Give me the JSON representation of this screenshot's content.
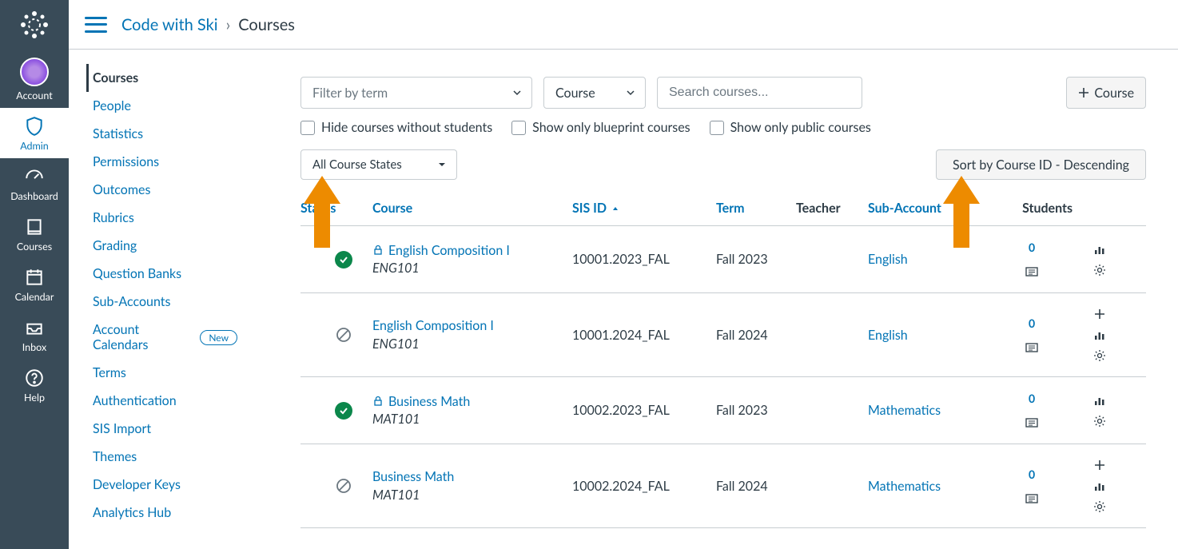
{
  "globalNav": {
    "items": [
      {
        "label": "Account"
      },
      {
        "label": "Admin"
      },
      {
        "label": "Dashboard"
      },
      {
        "label": "Courses"
      },
      {
        "label": "Calendar"
      },
      {
        "label": "Inbox"
      },
      {
        "label": "Help"
      }
    ]
  },
  "breadcrumb": {
    "root": "Code with Ski",
    "sep": "›",
    "current": "Courses"
  },
  "subNav": {
    "items": [
      {
        "label": "Courses",
        "active": true
      },
      {
        "label": "People"
      },
      {
        "label": "Statistics"
      },
      {
        "label": "Permissions"
      },
      {
        "label": "Outcomes"
      },
      {
        "label": "Rubrics"
      },
      {
        "label": "Grading"
      },
      {
        "label": "Question Banks"
      },
      {
        "label": "Sub-Accounts"
      },
      {
        "label": "Account Calendars",
        "badge": "New"
      },
      {
        "label": "Terms"
      },
      {
        "label": "Authentication"
      },
      {
        "label": "SIS Import"
      },
      {
        "label": "Themes"
      },
      {
        "label": "Developer Keys"
      },
      {
        "label": "Analytics Hub"
      }
    ]
  },
  "filters": {
    "termPlaceholder": "Filter by term",
    "typeSelected": "Course",
    "searchPlaceholder": "Search courses...",
    "addCourse": "Course",
    "hideWithoutStudents": "Hide courses without students",
    "onlyBlueprint": "Show only blueprint courses",
    "onlyPublic": "Show only public courses",
    "stateSelected": "All Course States",
    "sortLabel": "Sort by Course ID - Descending"
  },
  "columns": {
    "status": "Status",
    "course": "Course",
    "sisId": "SIS ID",
    "term": "Term",
    "teacher": "Teacher",
    "subAccount": "Sub-Account",
    "students": "Students"
  },
  "rows": [
    {
      "status": "published",
      "locked": true,
      "name": "English Composition I",
      "code": "ENG101",
      "sis": "10001.2023_FAL",
      "term": "Fall 2023",
      "teacher": "",
      "sub": "English",
      "students": "0",
      "blueprint": true,
      "addable": false
    },
    {
      "status": "unpublished",
      "locked": false,
      "name": "English Composition I",
      "code": "ENG101",
      "sis": "10001.2024_FAL",
      "term": "Fall 2024",
      "teacher": "",
      "sub": "English",
      "students": "0",
      "blueprint": true,
      "addable": true
    },
    {
      "status": "published",
      "locked": true,
      "name": "Business Math",
      "code": "MAT101",
      "sis": "10002.2023_FAL",
      "term": "Fall 2023",
      "teacher": "",
      "sub": "Mathematics",
      "students": "0",
      "blueprint": true,
      "addable": false
    },
    {
      "status": "unpublished",
      "locked": false,
      "name": "Business Math",
      "code": "MAT101",
      "sis": "10002.2024_FAL",
      "term": "Fall 2024",
      "teacher": "",
      "sub": "Mathematics",
      "students": "0",
      "blueprint": true,
      "addable": true
    }
  ]
}
